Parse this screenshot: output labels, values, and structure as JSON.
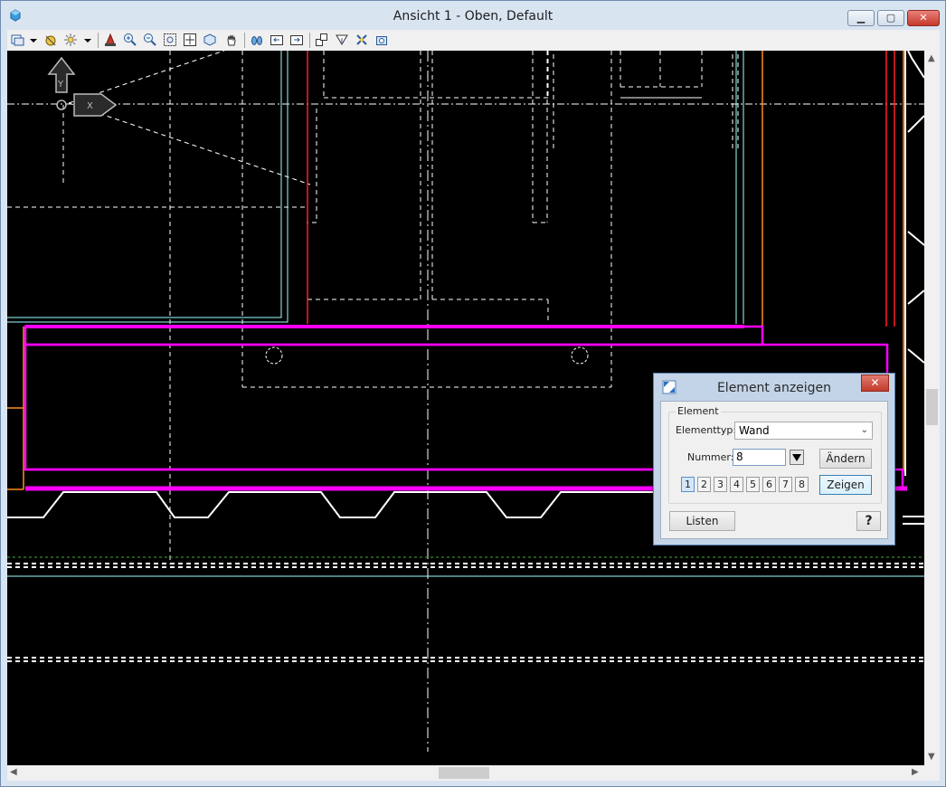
{
  "window": {
    "title": "Ansicht 1 - Oben, Default",
    "minimize_glyph": "▁",
    "maximize_glyph": "▢",
    "close_glyph": "✕"
  },
  "toolbar": {
    "icons": [
      "view-attributes-icon",
      "update-view-icon",
      "render-view-icon",
      "fence-icon",
      "zoom-in-icon",
      "zoom-out-icon",
      "window-area-icon",
      "fit-view-icon",
      "rotate-view-icon",
      "pan-view-icon",
      "walk-icon",
      "previous-view-icon",
      "next-view-icon",
      "copy-view-icon",
      "view-clip-icon",
      "clip-volume-icon",
      "camera-icon"
    ]
  },
  "dialog": {
    "title": "Element anzeigen",
    "close_glyph": "✕",
    "group_label": "Element",
    "elementtyp_label": "Elementtyp:",
    "elementtyp_value": "Wand",
    "nummer_label": "Nummer:",
    "nummer_value": "8",
    "aendern_label": "Ändern",
    "zeigen_label": "Zeigen",
    "numbers": [
      "1",
      "2",
      "3",
      "4",
      "5",
      "6",
      "7",
      "8"
    ],
    "active_number": "1",
    "listen_label": "Listen",
    "help_label": "?"
  },
  "colors": {
    "magenta": "#ff00ff",
    "red": "#ff0000",
    "cyan": "#a0ffff",
    "orange": "#ff8c1a",
    "white": "#ffffff"
  }
}
